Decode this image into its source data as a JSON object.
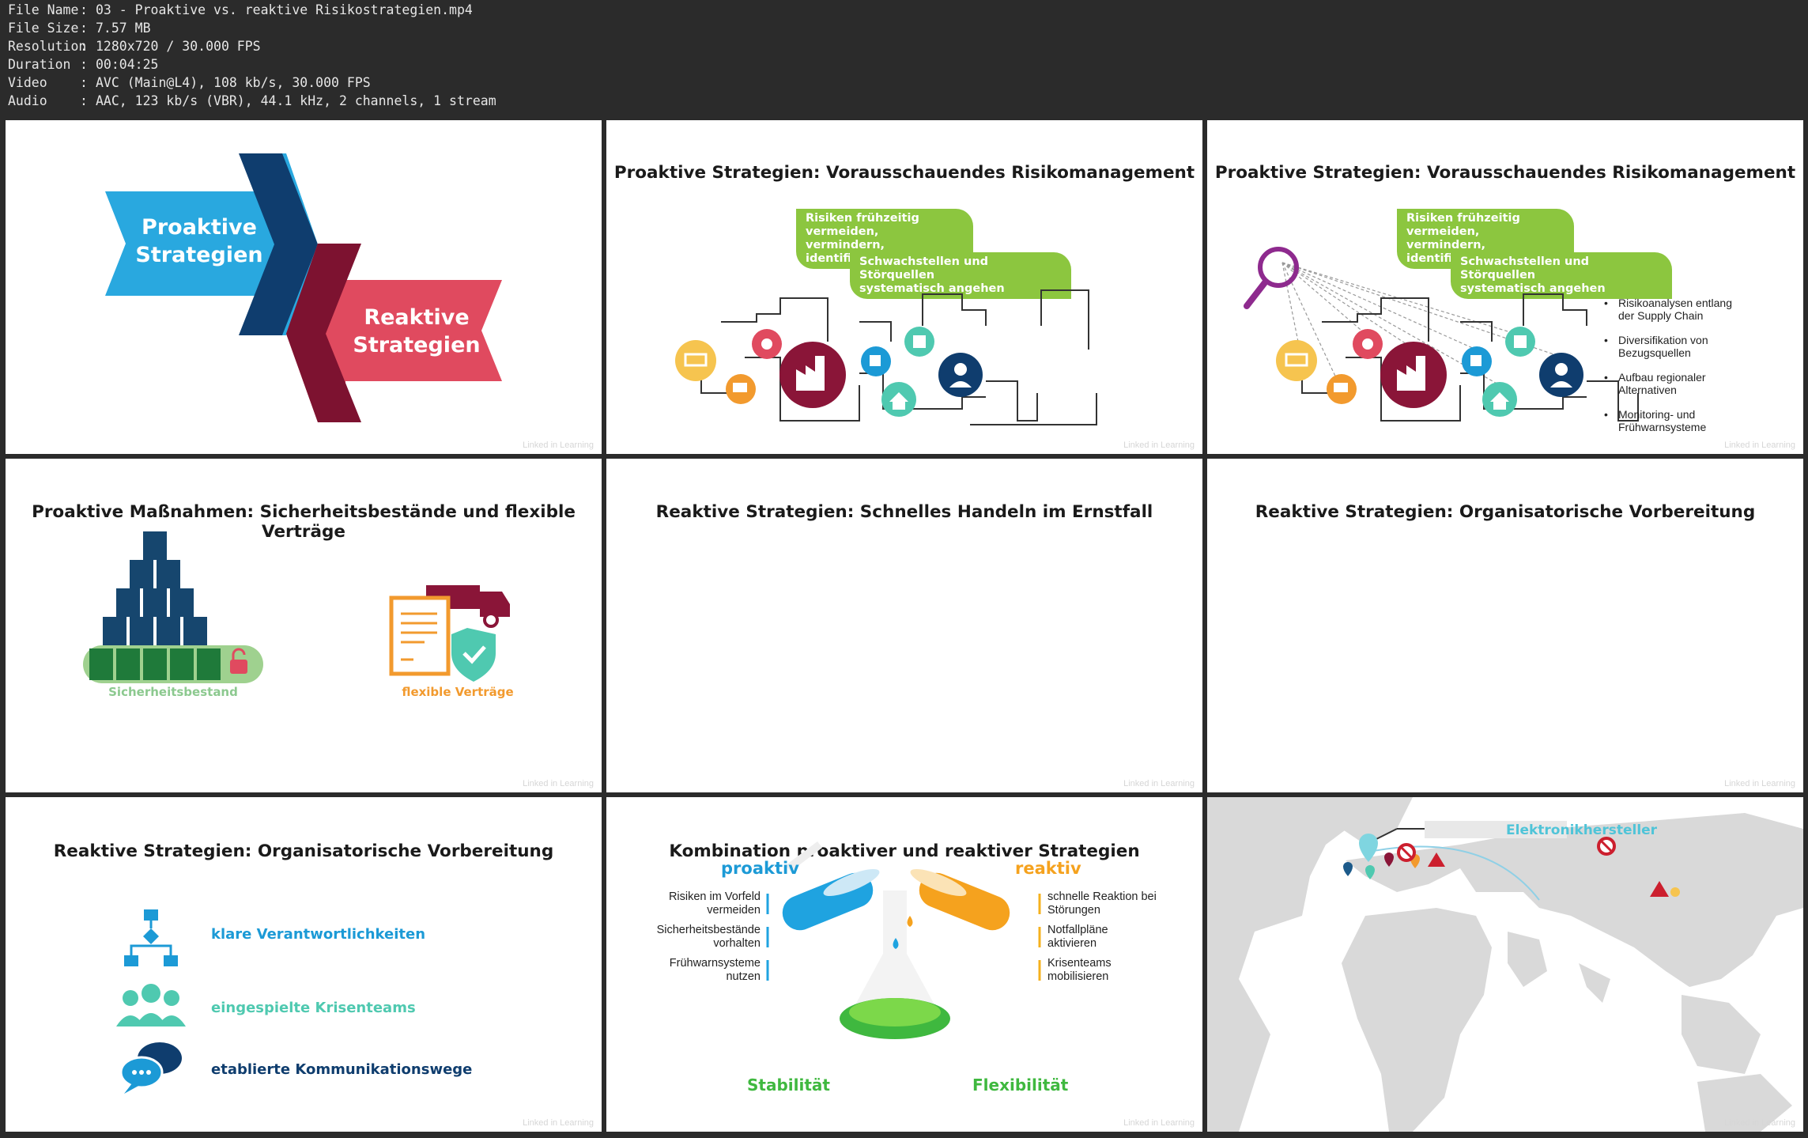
{
  "file_info": [
    {
      "key": "File Name",
      "value": "03 - Proaktive vs. reaktive Risikostrategien.mp4"
    },
    {
      "key": "File Size",
      "value": "7.57 MB"
    },
    {
      "key": "Resolution",
      "value": "1280x720 / 30.000 FPS"
    },
    {
      "key": "Duration",
      "value": "00:04:25"
    },
    {
      "key": "Video",
      "value": "AVC (Main@L4), 108 kb/s, 30.000 FPS"
    },
    {
      "key": "Audio",
      "value": "AAC, 123 kb/s (VBR), 44.1 kHz, 2 channels, 1 stream"
    }
  ],
  "separator": ":",
  "watermark": "Linked in Learning",
  "thumb1": {
    "proaktiv_line1": "Proaktive",
    "proaktiv_line2": "Strategien",
    "reaktiv_line1": "Reaktive",
    "reaktiv_line2": "Strategien"
  },
  "thumb2": {
    "title": "Proaktive Strategien: Vorausschauendes Risikomanagement",
    "box1_l1": "Risiken frühzeitig vermeiden,",
    "box1_l2": "vermindern, identifizieren",
    "box2_l1": "Schwachstellen und Störquellen",
    "box2_l2": "systematisch angehen"
  },
  "thumb3": {
    "title": "Proaktive Strategien: Vorausschauendes Risikomanagement",
    "box1_l1": "Risiken frühzeitig vermeiden,",
    "box1_l2": "vermindern, identifizieren",
    "box2_l1": "Schwachstellen und Störquellen",
    "box2_l2": "systematisch angehen",
    "bullets": [
      {
        "l1": "Risikoanalysen entlang",
        "l2": "der Supply Chain"
      },
      {
        "l1": "Diversifikation von",
        "l2": "Bezugsquellen"
      },
      {
        "l1": "Aufbau regionaler",
        "l2": "Alternativen"
      },
      {
        "l1": "Monitoring- und",
        "l2": "Frühwarnsysteme"
      }
    ]
  },
  "thumb4": {
    "title": "Proaktive Maßnahmen: Sicherheitsbestände und flexible Verträge",
    "label_left": "Sicherheitsbestand",
    "label_right": "flexible Verträge"
  },
  "thumb5": {
    "title": "Reaktive Strategien: Schnelles Handeln im Ernstfall"
  },
  "thumb6": {
    "title": "Reaktive Strategien: Organisatorische Vorbereitung"
  },
  "thumb7": {
    "title": "Reaktive Strategien: Organisatorische Vorbereitung",
    "items": [
      "klare Verantwortlichkeiten",
      "eingespielte Krisenteams",
      "etablierte Kommunikationswege"
    ]
  },
  "thumb8": {
    "title": "Kombination proaktiver und reaktiver Strategien",
    "proaktiv": "proaktiv",
    "reaktiv": "reaktiv",
    "left_items": [
      {
        "l1": "Risiken im Vorfeld",
        "l2": "vermeiden"
      },
      {
        "l1": "Sicherheitsbestände",
        "l2": "vorhalten"
      },
      {
        "l1": "Frühwarnsysteme",
        "l2": "nutzen"
      }
    ],
    "right_items": [
      {
        "l1": "schnelle Reaktion bei",
        "l2": "Störungen"
      },
      {
        "l1": "Notfallpläne",
        "l2": "aktivieren"
      },
      {
        "l1": "Krisenteams",
        "l2": "mobilisieren"
      }
    ],
    "stabilitaet": "Stabilität",
    "flexibilitaet": "Flexibilität"
  },
  "thumb9": {
    "callout": "Elektronikhersteller"
  },
  "colors": {
    "green": "#8cc63f",
    "teal": "#4fc9b0",
    "blue": "#1c9ad6",
    "navy": "#0f3d6e",
    "red": "#e04a5f",
    "maroon": "#7d1230",
    "orange": "#f29a2e",
    "yellow": "#f6c44f"
  }
}
